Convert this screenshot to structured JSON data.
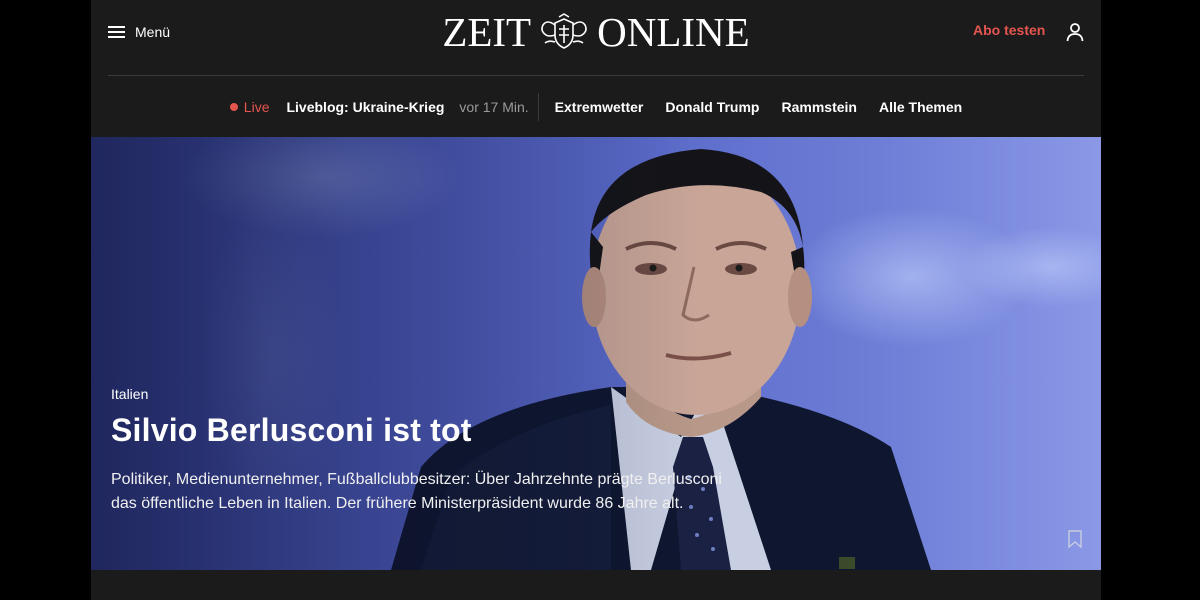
{
  "header": {
    "menu_label": "Menü",
    "logo_left": "ZEIT",
    "logo_right": "ONLINE",
    "abo_label": "Abo testen"
  },
  "topics": {
    "live_label": "Live",
    "liveblog": "Liveblog: Ukraine-Krieg",
    "liveblog_time": "vor 17 Min.",
    "items": [
      "Extremwetter",
      "Donald Trump",
      "Rammstein",
      "Alle Themen"
    ]
  },
  "hero": {
    "kicker": "Italien",
    "headline": "Silvio Berlusconi ist tot",
    "teaser": "Politiker, Medienunternehmer, Fußballclubbesitzer: Über Jahrzehnte prägte Berlusconi das öffentliche Leben in Italien. Der frühere Ministerpräsident wurde 86 Jahre alt."
  },
  "colors": {
    "accent_red": "#e5554f",
    "header_bg": "#1b1b1b",
    "outer_bg": "#000000"
  },
  "icons": [
    "hamburger-menu-icon",
    "crest-icon",
    "user-icon",
    "bookmark-icon"
  ]
}
